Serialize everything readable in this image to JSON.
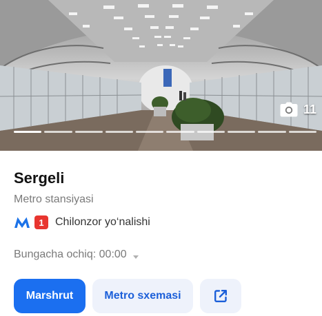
{
  "photo": {
    "count": "11",
    "pager_segments": 10,
    "active_segment": 0
  },
  "station": {
    "title": "Sergeli",
    "subtitle": "Metro stansiyasi",
    "line_number": "1",
    "line_name": "Chilonzor yo‘nalishi",
    "line_color": "#e8352f",
    "metro_icon_color": "#1c73e8"
  },
  "hours": {
    "label": "Bungacha ochiq: 00:00"
  },
  "actions": {
    "route_label": "Marshrut",
    "scheme_label": "Metro sxemasi",
    "share_icon": "external-link-icon"
  },
  "colors": {
    "accent": "#1b6ff0",
    "accent_text": "#1b5fd9",
    "secondary_bg": "#eef2fb"
  }
}
